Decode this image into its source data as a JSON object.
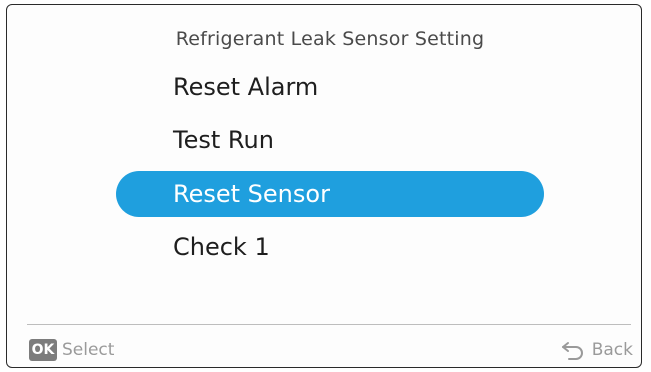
{
  "screen": {
    "title": "Refrigerant Leak Sensor Setting"
  },
  "menu": {
    "items": [
      {
        "label": "Reset Alarm",
        "selected": false
      },
      {
        "label": "Test Run",
        "selected": false
      },
      {
        "label": "Reset Sensor",
        "selected": true
      },
      {
        "label": "Check 1",
        "selected": false
      }
    ]
  },
  "footer": {
    "ok_key": "OK",
    "select_label": "Select",
    "back_label": "Back"
  },
  "colors": {
    "highlight": "#1f9fde",
    "text": "#1e1e1e",
    "muted": "#9a9a9a",
    "key_bg": "#7c7c7c"
  },
  "icons": {
    "back": "return-arrow-icon"
  }
}
